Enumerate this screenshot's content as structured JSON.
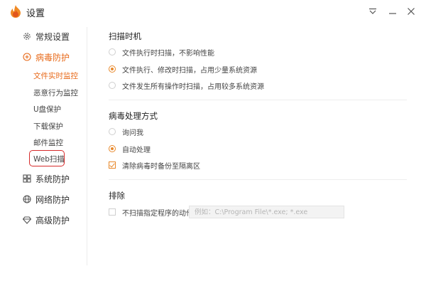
{
  "window": {
    "title": "设置",
    "accent_color": "#e86a1a",
    "highlight_color": "#d62b2b",
    "controls": [
      "dropdown-icon",
      "minimize-icon",
      "close-icon"
    ]
  },
  "sidebar": {
    "items": [
      {
        "label": "常规设置",
        "icon": "gear-icon"
      },
      {
        "label": "病毒防护",
        "icon": "plus-circle-icon"
      },
      {
        "label": "系统防护",
        "icon": "windows-grid-icon"
      },
      {
        "label": "网络防护",
        "icon": "globe-icon"
      },
      {
        "label": "高级防护",
        "icon": "diamond-icon"
      }
    ],
    "subitems": [
      {
        "label": "文件实时监控"
      },
      {
        "label": "恶意行为监控"
      },
      {
        "label": "U盘保护"
      },
      {
        "label": "下载保护"
      },
      {
        "label": "邮件监控"
      },
      {
        "label": "Web扫描"
      }
    ]
  },
  "scan_timing": {
    "title": "扫描时机",
    "options": [
      "文件执行时扫描，不影响性能",
      "文件执行、修改时扫描，占用少量系统资源",
      "文件发生所有操作时扫描，占用较多系统资源"
    ],
    "selected": 1
  },
  "virus_handling": {
    "title": "病毒处理方式",
    "options": [
      "询问我",
      "自动处理"
    ],
    "selected": 1,
    "backup_label": "清除病毒时备份至隔离区",
    "backup_checked": true
  },
  "exclude": {
    "title": "排除",
    "checkbox_label": "不扫描指定程序的动作",
    "checkbox_checked": false,
    "input_placeholder": "例如：C:\\Program File\\*.exe; *.exe"
  }
}
